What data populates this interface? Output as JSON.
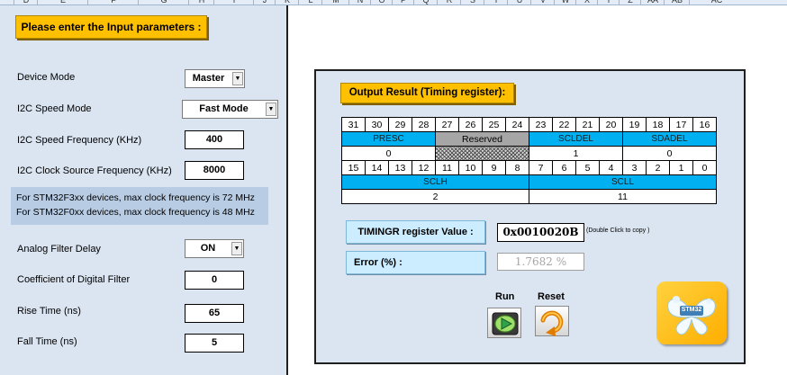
{
  "spreadsheet": {
    "columns": [
      "D",
      "E",
      "F",
      "G",
      "H",
      "I",
      "J",
      "K",
      "L",
      "M",
      "N",
      "O",
      "P",
      "Q",
      "R",
      "S",
      "T",
      "U",
      "V",
      "W",
      "X",
      "Y",
      "Z",
      "AA",
      "AB",
      "AC"
    ]
  },
  "left_panel": {
    "title": "Please enter the Input parameters :",
    "device_mode": {
      "label": "Device Mode",
      "value": "Master"
    },
    "speed_mode": {
      "label": "I2C Speed Mode",
      "value": "Fast Mode"
    },
    "speed_freq": {
      "label": "I2C Speed Frequency (KHz)",
      "value": "400"
    },
    "clock_freq": {
      "label": "I2C Clock Source Frequency  (KHz)",
      "value": "8000"
    },
    "note": {
      "line1": "For STM32F3xx devices, max clock frequency is 72 MHz",
      "line2": "For STM32F0xx devices, max clock frequency is 48 MHz"
    },
    "analog_filter": {
      "label": "Analog Filter Delay",
      "value": "ON"
    },
    "digital_filter": {
      "label": "Coefficient of Digital Filter",
      "value": "0"
    },
    "rise_time": {
      "label": "Rise Time (ns)",
      "value": "65"
    },
    "fall_time": {
      "label": "Fall Time (ns)",
      "value": "5"
    }
  },
  "right_panel": {
    "title": "Output Result (Timing register):",
    "register": {
      "bits_high": [
        "31",
        "30",
        "29",
        "28",
        "27",
        "26",
        "25",
        "24",
        "23",
        "22",
        "21",
        "20",
        "19",
        "18",
        "17",
        "16"
      ],
      "fields_high": [
        {
          "name": "PRESC",
          "value": "0"
        },
        {
          "name": "Reserved",
          "value": ""
        },
        {
          "name": "SCLDEL",
          "value": "1"
        },
        {
          "name": "SDADEL",
          "value": "0"
        }
      ],
      "bits_low": [
        "15",
        "14",
        "13",
        "12",
        "11",
        "10",
        "9",
        "8",
        "7",
        "6",
        "5",
        "4",
        "3",
        "2",
        "1",
        "0"
      ],
      "fields_low": [
        {
          "name": "SCLH",
          "value": "2"
        },
        {
          "name": "SCLL",
          "value": "11"
        }
      ]
    },
    "timingr_label": "TIMINGR register Value :",
    "timingr_value": "0x0010020B",
    "copy_hint": "(Double Click to copy )",
    "error_label": "Error (%) :",
    "error_value": "1.7682 %",
    "run_label": "Run",
    "reset_label": "Reset",
    "logo_text": "STM32",
    "colors": {
      "panel_bg": "#dbe5f1",
      "yellow": "#ffc000",
      "field_blue": "#00b0f0",
      "label_blue": "#ccecff"
    }
  }
}
